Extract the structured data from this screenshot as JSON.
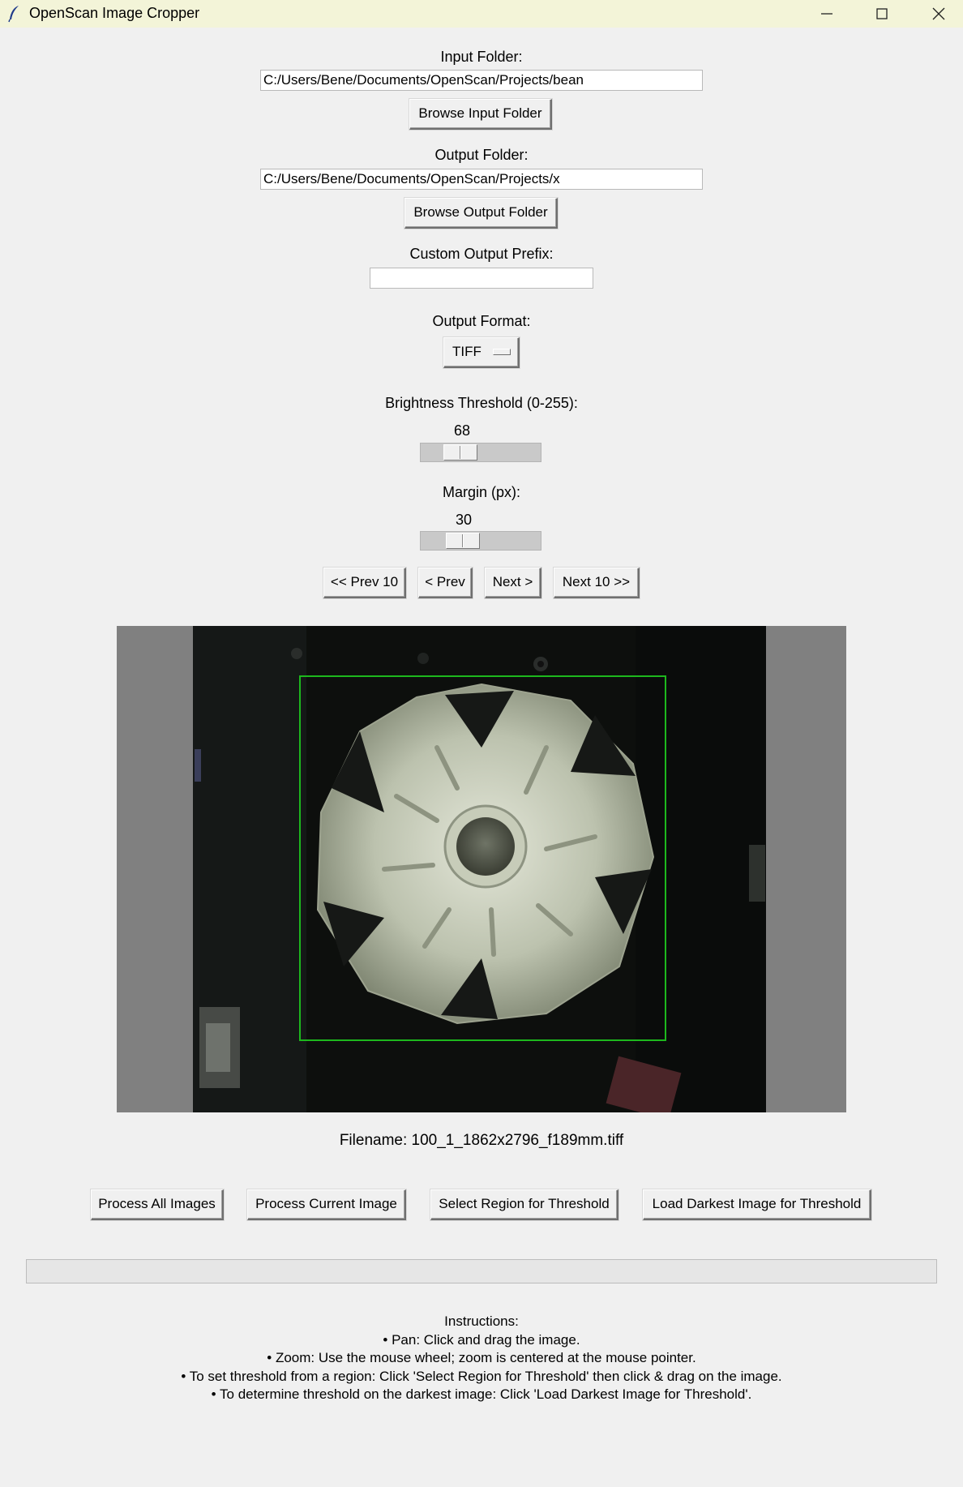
{
  "window": {
    "title": "OpenScan Image Cropper",
    "icon": "feather-icon"
  },
  "input_folder": {
    "label": "Input Folder:",
    "value": "C:/Users/Bene/Documents/OpenScan/Projects/bean",
    "browse_label": "Browse Input Folder"
  },
  "output_folder": {
    "label": "Output Folder:",
    "value": "C:/Users/Bene/Documents/OpenScan/Projects/x",
    "browse_label": "Browse Output Folder"
  },
  "prefix": {
    "label": "Custom Output Prefix:",
    "value": ""
  },
  "format": {
    "label": "Output Format:",
    "selected": "TIFF"
  },
  "threshold": {
    "label": "Brightness Threshold (0-255):",
    "value": "68",
    "min": 0,
    "max": 255
  },
  "margin": {
    "label": "Margin (px):",
    "value": "30"
  },
  "nav": {
    "prev10": "<< Prev 10",
    "prev": "< Prev",
    "next": "Next >",
    "next10": "Next 10 >>"
  },
  "preview": {
    "filename_line": "Filename:  100_1_1862x2796_f189mm.tiff",
    "crop_box_color": "#1db81d"
  },
  "actions": {
    "process_all": "Process All Images",
    "process_current": "Process Current Image",
    "select_region": "Select Region for Threshold",
    "load_darkest": "Load Darkest Image for Threshold"
  },
  "progress": {
    "value": 0
  },
  "instructions": {
    "heading": "Instructions:",
    "lines": [
      "• Pan: Click and drag the image.",
      "• Zoom: Use the mouse wheel; zoom is centered at the mouse pointer.",
      "• To set threshold from a region: Click 'Select Region for Threshold' then click & drag on the image.",
      "• To determine threshold on the darkest image: Click 'Load Darkest Image for Threshold'."
    ]
  }
}
